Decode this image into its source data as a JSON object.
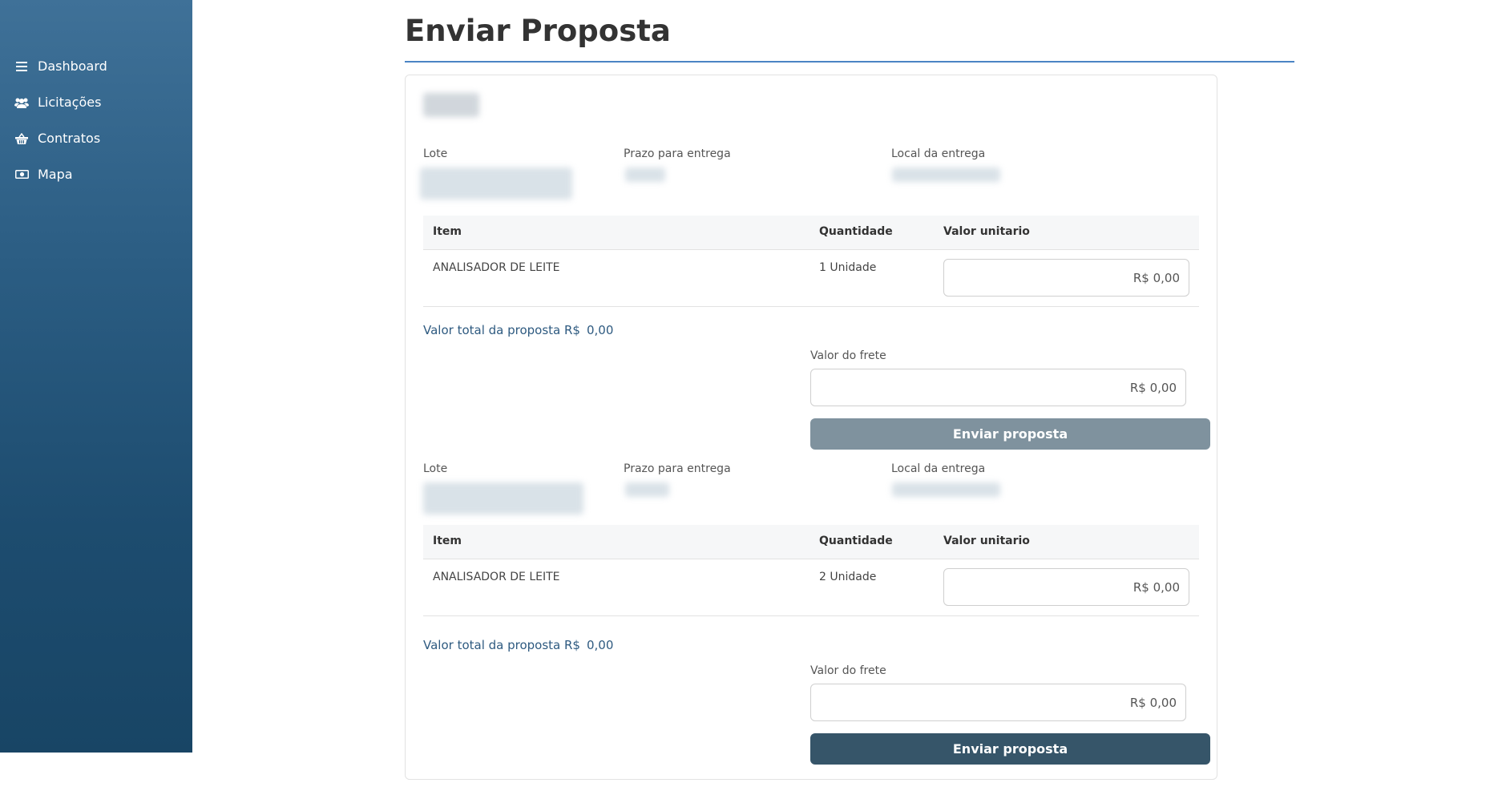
{
  "sidebar": {
    "items": [
      {
        "label": "Dashboard",
        "icon": "menu-icon"
      },
      {
        "label": "Licitações",
        "icon": "users-icon"
      },
      {
        "label": "Contratos",
        "icon": "basket-icon"
      },
      {
        "label": "Mapa",
        "icon": "money-icon"
      }
    ]
  },
  "page": {
    "title": "Enviar Proposta"
  },
  "lots": [
    {
      "labels": {
        "lote": "Lote",
        "prazo": "Prazo para entrega",
        "local": "Local da entrega"
      },
      "table": {
        "headers": [
          "Item",
          "Quantidade",
          "Valor unitario"
        ],
        "rows": [
          {
            "item": "ANALISADOR DE LEITE",
            "quantidade": "1 Unidade",
            "valor_unitario": "R$ 0,00"
          }
        ]
      },
      "total_label": "Valor total da proposta R$",
      "total_value": "0,00",
      "frete_label": "Valor do frete",
      "frete_value": "R$ 0,00",
      "button_label": "Enviar proposta",
      "button_enabled": false
    },
    {
      "labels": {
        "lote": "Lote",
        "prazo": "Prazo para entrega",
        "local": "Local da entrega"
      },
      "table": {
        "headers": [
          "Item",
          "Quantidade",
          "Valor unitario"
        ],
        "rows": [
          {
            "item": "ANALISADOR DE LEITE",
            "quantidade": "2 Unidade",
            "valor_unitario": "R$ 0,00"
          }
        ]
      },
      "total_label": "Valor total da proposta R$",
      "total_value": "0,00",
      "frete_label": "Valor do frete",
      "frete_value": "R$ 0,00",
      "button_label": "Enviar proposta",
      "button_enabled": true
    }
  ],
  "colors": {
    "sidebar_top": "#3f7198",
    "sidebar_bottom": "#184565",
    "accent_rule": "#4a84c4",
    "total_text": "#2e5a80",
    "button_disabled": "#7f929e",
    "button_active": "#365569"
  }
}
